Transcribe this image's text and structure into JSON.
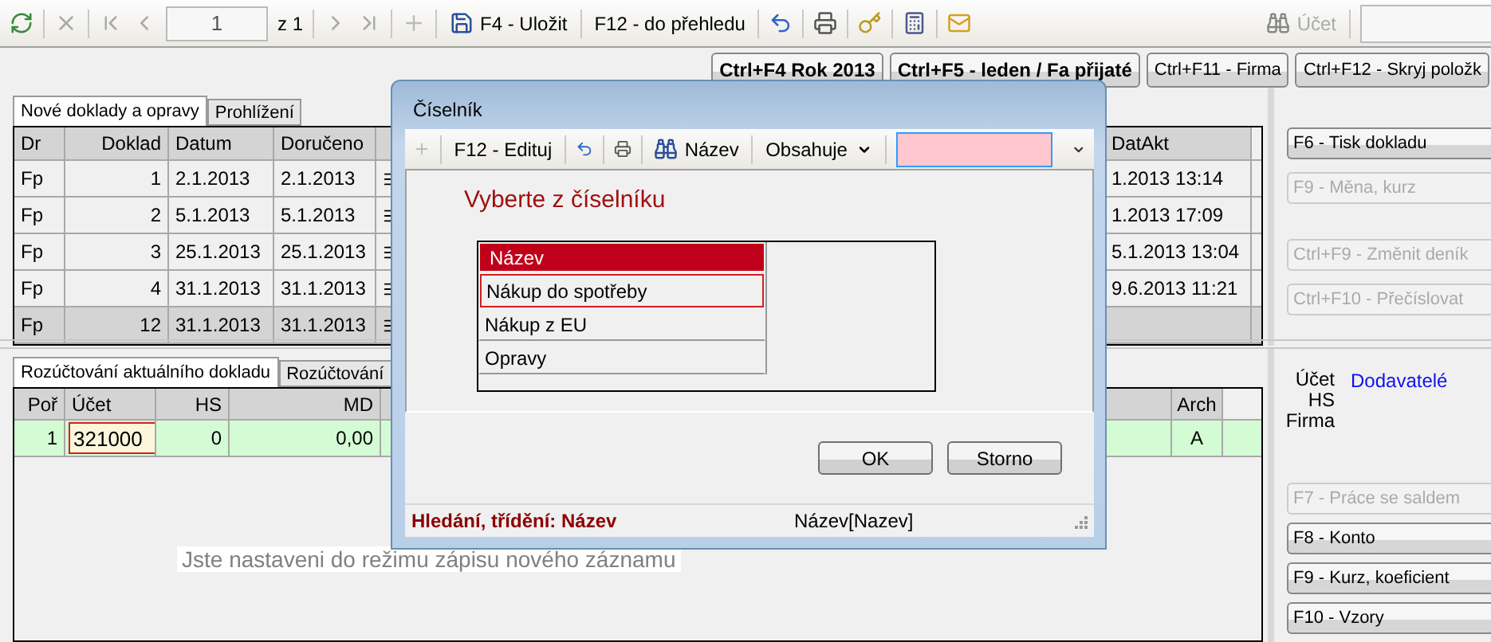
{
  "toolbar": {
    "page": "1",
    "page_total": "z 1",
    "save": "F4 - Uložit",
    "overview": "F12 - do přehledu",
    "search_label": "Účet"
  },
  "shortcut_buttons": [
    {
      "label": "Ctrl+F4 Rok 2013",
      "emphasized": true
    },
    {
      "label": "Ctrl+F5 - leden / Fa přijaté",
      "emphasized": true
    },
    {
      "label": "Ctrl+F11 - Firma",
      "emphasized": false
    },
    {
      "label": "Ctrl+F12 - Skryj položk",
      "emphasized": false
    }
  ],
  "documents": {
    "tabs": [
      {
        "label": "Nové doklady a opravy",
        "selected": true
      },
      {
        "label": "Prohlížení",
        "selected": false
      }
    ],
    "columns": [
      "Dr",
      "Doklad",
      "Datum",
      "Doručeno",
      "DatAkt"
    ],
    "rows": [
      {
        "dr": "Fp",
        "doklad": "1",
        "datum": "2.1.2013",
        "doruceno": "2.1.2013",
        "dat_akt": "1.2013 13:14",
        "selected": false
      },
      {
        "dr": "Fp",
        "doklad": "2",
        "datum": "5.1.2013",
        "doruceno": "5.1.2013",
        "dat_akt": "1.2013 17:09",
        "selected": false
      },
      {
        "dr": "Fp",
        "doklad": "3",
        "datum": "25.1.2013",
        "doruceno": "25.1.2013",
        "dat_akt": "5.1.2013 13:04",
        "selected": false
      },
      {
        "dr": "Fp",
        "doklad": "4",
        "datum": "31.1.2013",
        "doruceno": "31.1.2013",
        "dat_akt": "9.6.2013 11:21",
        "selected": false
      },
      {
        "dr": "Fp",
        "doklad": "12",
        "datum": "31.1.2013",
        "doruceno": "31.1.2013",
        "selected": true
      }
    ]
  },
  "document_actions": [
    {
      "label": "F6 - Tisk dokladu",
      "disabled": false
    },
    {
      "label": "F9 - Měna, kurz",
      "disabled": true
    },
    {
      "label": "Ctrl+F9 - Změnit deník",
      "disabled": true
    },
    {
      "label": "Ctrl+F10 - Přečíslovat",
      "disabled": true
    }
  ],
  "allocation": {
    "tabs": [
      {
        "label": "Rozúčtování aktuálního dokladu",
        "selected": true
      },
      {
        "label": "Rozúčtování",
        "selected": false
      }
    ],
    "columns": [
      "Poř",
      "Účet",
      "HS",
      "MD",
      "Arch"
    ],
    "rows": [
      {
        "por": "1",
        "ucet": "321000",
        "hs": "0",
        "md": "0,00",
        "arch": "A"
      }
    ],
    "message": "Jste nastaveni do režimu zápisu nového záznamu"
  },
  "info": {
    "labels": [
      "Účet",
      "HS",
      "Firma"
    ],
    "account_value": "Dodavatelé"
  },
  "allocation_actions": [
    {
      "label": "F7 - Práce se saldem",
      "disabled": true
    },
    {
      "label": "F8 - Konto",
      "disabled": false
    },
    {
      "label": "F9 - Kurz, koeficient",
      "disabled": false
    },
    {
      "label": "F10 - Vzory",
      "disabled": false
    }
  ],
  "dialog": {
    "title": "Číselník",
    "edit": "F12 - Edituj",
    "search_field": "Název",
    "match_mode": "Obsahuje",
    "heading": "Vyberte z číselníku",
    "list_column": "Název",
    "items": [
      {
        "label": "Nákup do spotřeby",
        "selected": true
      },
      {
        "label": "Nákup z EU",
        "selected": false
      },
      {
        "label": "Opravy",
        "selected": false
      }
    ],
    "buttons": [
      "OK",
      "Storno"
    ],
    "status": {
      "search": "Hledání, třídění: Název",
      "field": "Název[Nazev]"
    }
  }
}
